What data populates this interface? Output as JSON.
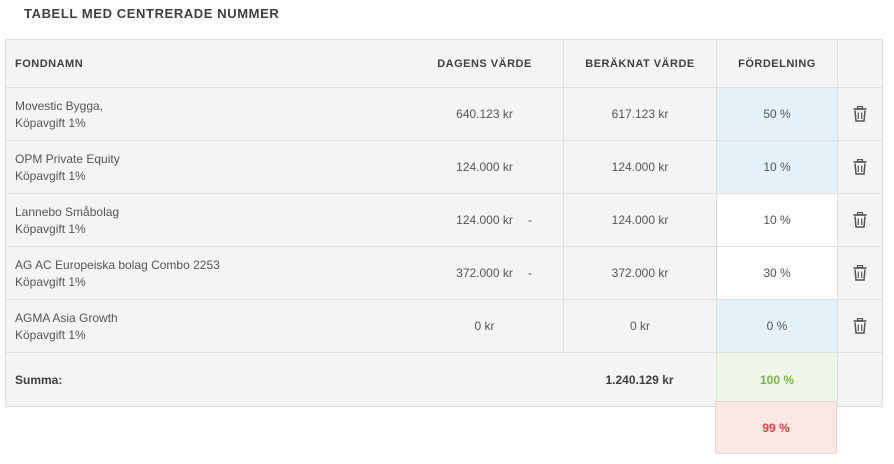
{
  "title": "TABELL MED CENTRERADE NUMMER",
  "headers": {
    "fondnamn": "FONDNAMN",
    "dagens": "DAGENS VÄRDE",
    "beraknat": "BERÄKNAT VÄRDE",
    "fordelning": "FÖRDELNING"
  },
  "rows": [
    {
      "name": "Movestic Bygga,",
      "fee": "Köpavgift 1%",
      "dagens": "640.123 kr",
      "beraknat": "617.123 kr",
      "fordelning": "50 %",
      "dash": ""
    },
    {
      "name": "OPM Private Equity",
      "fee": "Köpavgift 1%",
      "dagens": "124.000 kr",
      "beraknat": "124.000 kr",
      "fordelning": "10 %",
      "dash": ""
    },
    {
      "name": "Lannebo Småbolag",
      "fee": "Köpavgift 1%",
      "dagens": "124.000 kr",
      "beraknat": "124.000 kr",
      "fordelning": "10 %",
      "dash": "-"
    },
    {
      "name": "AG AC Europeiska bolag Combo 2253",
      "fee": "Köpavgift 1%",
      "dagens": "372.000 kr",
      "beraknat": "372.000 kr",
      "fordelning": "30 %",
      "dash": "-"
    },
    {
      "name": "AGMA Asia Growth",
      "fee": "Köpavgift 1%",
      "dagens": "0 kr",
      "beraknat": "0 kr",
      "fordelning": "0 %",
      "dash": ""
    }
  ],
  "summary": {
    "label": "Summa:",
    "total": "1.240.129 kr",
    "percent": "100 %",
    "error_percent": "99 %"
  },
  "colors": {
    "allocation_highlight": "#e3f2f9",
    "sum_ok": "#7cb342",
    "sum_error": "#e0443a"
  },
  "icons": {
    "delete": "trash-icon"
  }
}
